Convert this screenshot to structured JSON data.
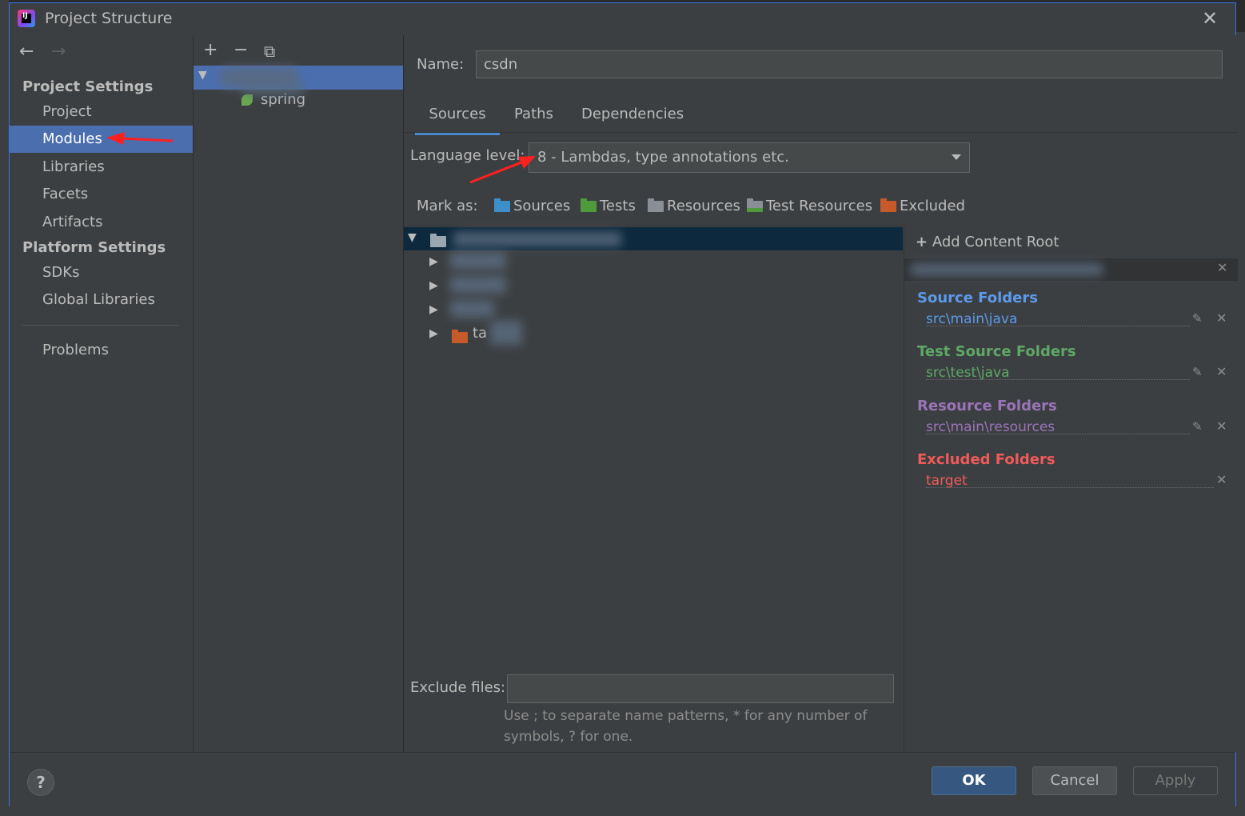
{
  "window": {
    "title": "Project Structure"
  },
  "nav": {
    "project_settings_header": "Project Settings",
    "project_items": [
      "Project",
      "Modules",
      "Libraries",
      "Facets",
      "Artifacts"
    ],
    "platform_settings_header": "Platform Settings",
    "platform_items": [
      "SDKs",
      "Global Libraries"
    ],
    "problems": "Problems",
    "selected": "Modules"
  },
  "modules": {
    "child_label": "spring"
  },
  "module": {
    "name_label": "Name:",
    "name_value": "csdn",
    "tabs": [
      "Sources",
      "Paths",
      "Dependencies"
    ],
    "active_tab": "Sources",
    "language_level_label": "Language level:",
    "language_level_value": "8 - Lambdas, type annotations etc.",
    "mark_as_label": "Mark as:",
    "mark_as": [
      {
        "label": "Sources",
        "color": "#3d8fc9"
      },
      {
        "label": "Tests",
        "color": "#4e9a3d"
      },
      {
        "label": "Resources",
        "color": "#8a8f96"
      },
      {
        "label": "Test Resources",
        "color": "#8a8f96"
      },
      {
        "label": "Excluded",
        "color": "#c75a2a"
      }
    ],
    "tree_visible_fragment": "ta",
    "exclude_files_label": "Exclude files:",
    "exclude_files_value": "",
    "exclude_hint": "Use ; to separate name patterns, * for any number of symbols, ? for one."
  },
  "content_root": {
    "add_label": "Add Content Root",
    "sections": [
      {
        "title": "Source Folders",
        "path": "src\\main\\java",
        "color": "#5c9aeb",
        "path_color": "#5c9aeb"
      },
      {
        "title": "Test Source Folders",
        "path": "src\\test\\java",
        "color": "#5ea865",
        "path_color": "#5ea865"
      },
      {
        "title": "Resource Folders",
        "path": "src\\main\\resources",
        "color": "#9a74b8",
        "path_color": "#9a74b8"
      },
      {
        "title": "Excluded Folders",
        "path": "target",
        "color": "#ef5a5a",
        "path_color": "#ef5a5a"
      }
    ]
  },
  "buttons": {
    "help": "?",
    "ok": "OK",
    "cancel": "Cancel",
    "apply": "Apply"
  },
  "colors": {
    "accent": "#4b6eaf",
    "ok": "#365880",
    "annotation": "#ff2020"
  }
}
